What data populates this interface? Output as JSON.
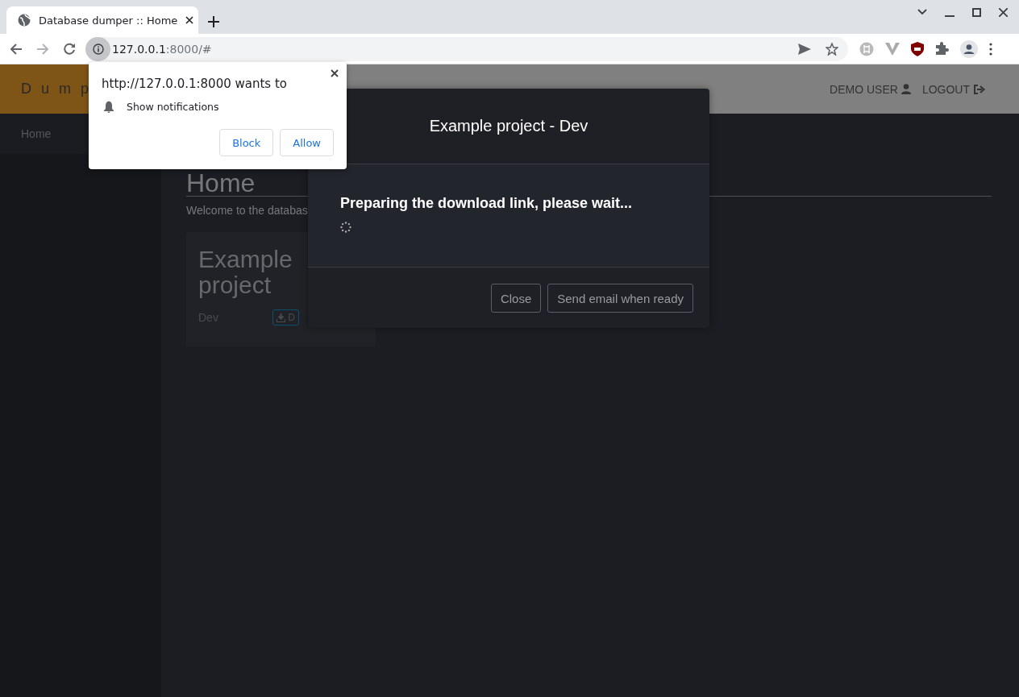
{
  "browser": {
    "tabs": [
      {
        "title": "Database dumper :: Home",
        "selected": true
      }
    ],
    "address": {
      "host": "127.0.0.1",
      "rest": ":8000/#"
    }
  },
  "permission_popup": {
    "title": "http://127.0.0.1:8000 wants to",
    "permission": "Show notifications",
    "buttons": [
      "Block",
      "Allow"
    ]
  },
  "navbar": {
    "brand": "Dump",
    "user": "DEMO USER",
    "logout": "LOGOUT"
  },
  "sidebar": {
    "items": [
      {
        "label": "Home",
        "selected": true
      }
    ]
  },
  "main": {
    "heading": "Home",
    "intro": "Welcome to the databas",
    "card": {
      "title": "Example project",
      "environment": "Dev",
      "button": "D"
    }
  },
  "modal": {
    "title": "Example project - Dev",
    "message": "Preparing the download link, please wait...",
    "buttons": [
      "Close",
      "Send email when ready"
    ]
  }
}
